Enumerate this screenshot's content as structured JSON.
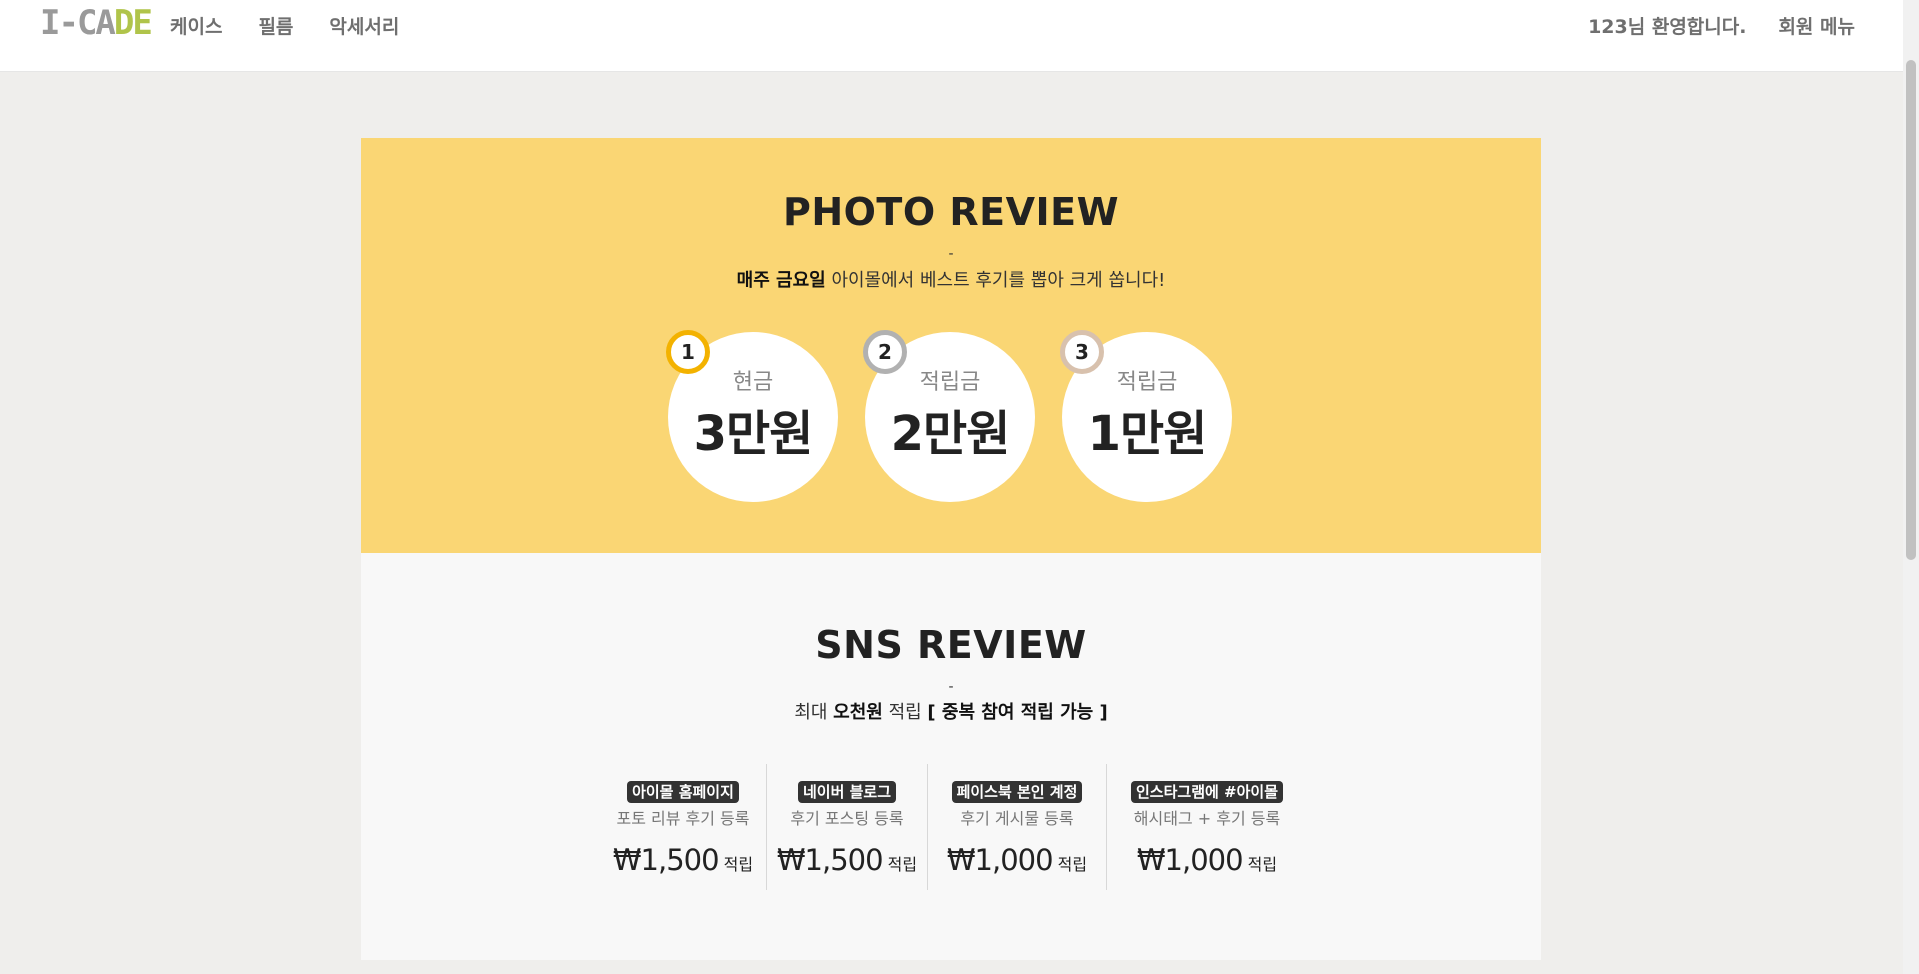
{
  "header": {
    "logo": {
      "part1": "I-CA",
      "part2": "DE"
    },
    "nav": [
      "케이스",
      "필름",
      "악세서리"
    ],
    "welcome": "123님 환영합니다.",
    "member_menu": "회원 메뉴"
  },
  "photo_review": {
    "title": "PHOTO REVIEW",
    "dash": "-",
    "desc_bold": "매주 금요일",
    "desc_rest": " 아이몰에서 베스트 후기를 뽑아 크게 쏩니다!",
    "prizes": [
      {
        "rank": "1",
        "kind": "현금",
        "amount": "3만원"
      },
      {
        "rank": "2",
        "kind": "적립금",
        "amount": "2만원"
      },
      {
        "rank": "3",
        "kind": "적립금",
        "amount": "1만원"
      }
    ]
  },
  "sns_review": {
    "title": "SNS REVIEW",
    "dash": "-",
    "desc_pre": "최대 ",
    "desc_bold1": "오천원",
    "desc_mid": " 적립 ",
    "desc_bold2": "[ 중복 참여 적립 가능 ]",
    "items": [
      {
        "badge": "아이몰 홈페이지",
        "sub": "포토 리뷰 후기 등록",
        "price": "₩1,500",
        "unit": "적립"
      },
      {
        "badge": "네이버 블로그",
        "sub": "후기 포스팅 등록",
        "price": "₩1,500",
        "unit": "적립"
      },
      {
        "badge": "페이스북 본인 계정",
        "sub": "후기 게시물 등록",
        "price": "₩1,000",
        "unit": "적립"
      },
      {
        "badge": "인스타그램에 #아이몰",
        "sub": "해시태그 + 후기 등록",
        "price": "₩1,000",
        "unit": "적립"
      }
    ]
  }
}
